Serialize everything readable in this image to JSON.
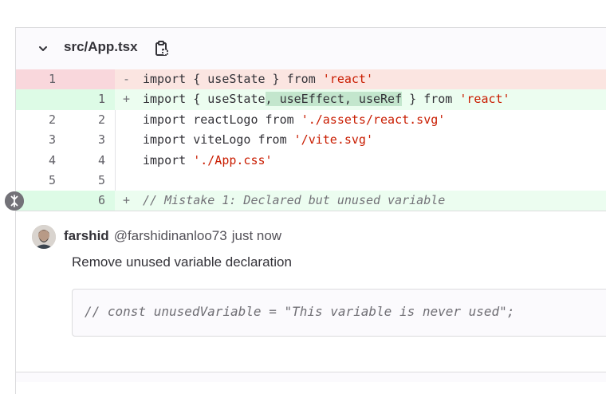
{
  "file": {
    "name": "src/App.tsx"
  },
  "diff": {
    "lines": [
      {
        "type": "del",
        "old": "1",
        "new": "",
        "marker": "-"
      },
      {
        "type": "add",
        "old": "",
        "new": "1",
        "marker": "+"
      },
      {
        "type": "ctx",
        "old": "2",
        "new": "2",
        "marker": ""
      },
      {
        "type": "ctx",
        "old": "3",
        "new": "3",
        "marker": ""
      },
      {
        "type": "ctx",
        "old": "4",
        "new": "4",
        "marker": ""
      },
      {
        "type": "ctx",
        "old": "5",
        "new": "5",
        "marker": ""
      },
      {
        "type": "add",
        "old": "",
        "new": "6",
        "marker": "+"
      }
    ],
    "code": {
      "l1_kw": "import { useState } from ",
      "l1_str": "'react'",
      "l2_a": "import { useState",
      "l2_hl": ", useEffect, useRef",
      "l2_b": " } from ",
      "l2_str": "'react'",
      "l3_kw": "import reactLogo from ",
      "l3_str": "'./assets/react.svg'",
      "l4_kw": "import viteLogo from ",
      "l4_str": "'/vite.svg'",
      "l5_kw": "import ",
      "l5_str": "'./App.css'",
      "l7_cmt": "// Mistake 1: Declared but unused variable"
    }
  },
  "note": {
    "author": "farshid",
    "handle": "@farshidinanloo73",
    "time": "just now",
    "body": "Remove unused variable declaration",
    "suggestion": "// const unusedVariable = \"This variable is never used\";"
  },
  "icons": {
    "collapse": "chevron-down-icon",
    "copy": "copy-file-path-icon",
    "comment": "comment-collapse-icon",
    "avatar": "user-avatar"
  },
  "colors": {
    "deleted_line_bg": "#fbe5e1",
    "added_line_bg": "#ecfdf0",
    "string": "#c91c00",
    "highlight": "#c3e6cd"
  }
}
